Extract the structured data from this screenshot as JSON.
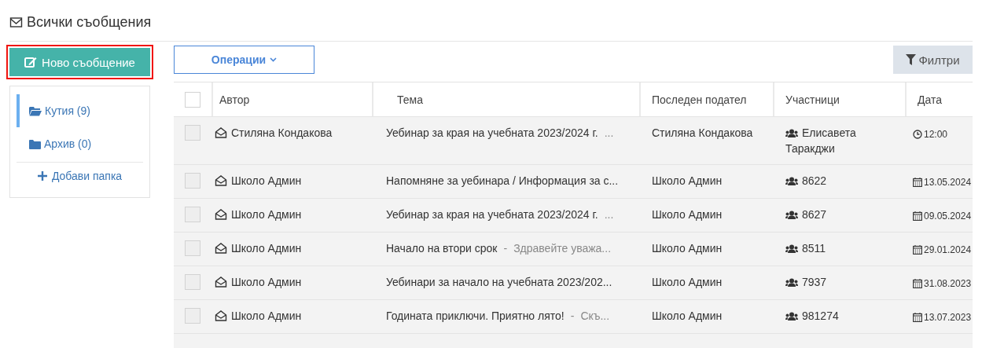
{
  "page_title": "Всички съобщения",
  "new_message_button": {
    "label": "Ново съобщение",
    "highlighted": true
  },
  "folders": [
    {
      "label": "Кутия (9)",
      "selected": true
    },
    {
      "label": "Архив (0)",
      "selected": false
    }
  ],
  "add_folder": "Добави папка",
  "operations_button": "Операции",
  "filters_button": "Филтри",
  "table": {
    "select_all_checked": false,
    "columns": [
      "Автор",
      "Тема",
      "Последен подател",
      "Участници",
      "Дата"
    ],
    "rows": [
      {
        "checked": false,
        "author": "Стиляна Кондакова",
        "subject": "Уебинар за края на учебната 2023/2024 г.",
        "preview": {
          "text": "..."
        },
        "last_sender": "Стиляна Кондакова",
        "participants": "Елисавета Таракджи",
        "date": {
          "kind": "time",
          "text": "12:00"
        }
      },
      {
        "checked": false,
        "author": "Школо Админ",
        "subject": "Напомняне за уебинара / Информация за с...",
        "last_sender": "Школо Админ",
        "participants": "8622",
        "date": {
          "kind": "date",
          "text": "13.05.2024"
        }
      },
      {
        "checked": false,
        "author": "Школо Админ",
        "subject": "Уебинар за края на учебната 2023/2024 г.",
        "preview": {
          "text": "..."
        },
        "last_sender": "Школо Админ",
        "participants": "8627",
        "date": {
          "kind": "date",
          "text": "09.05.2024"
        }
      },
      {
        "checked": false,
        "author": "Школо Админ",
        "subject": "Начало на втори срок",
        "preview": {
          "separator": "-",
          "text": "Здравейте уважа..."
        },
        "last_sender": "Школо Админ",
        "participants": "8511",
        "date": {
          "kind": "date",
          "text": "29.01.2024"
        }
      },
      {
        "checked": false,
        "author": "Школо Админ",
        "subject": "Уебинари за начало на учебната 2023/202...",
        "last_sender": "Школо Админ",
        "participants": "7937",
        "date": {
          "kind": "date",
          "text": "31.08.2023"
        }
      },
      {
        "checked": false,
        "author": "Школо Админ",
        "subject": "Годината приключи. Приятно лято!",
        "preview": {
          "separator": "-",
          "text": "Скъ..."
        },
        "last_sender": "Школо Админ",
        "participants": "981274",
        "date": {
          "kind": "date",
          "text": "13.07.2023"
        }
      }
    ]
  }
}
